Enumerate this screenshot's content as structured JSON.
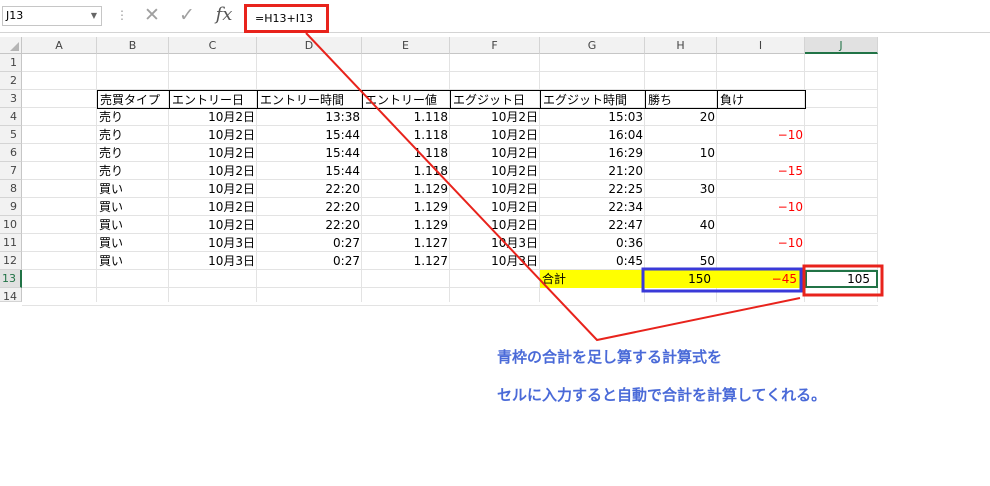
{
  "formula_bar": {
    "name_box": "J13",
    "formula": "=H13+I13",
    "fx_label": "fx"
  },
  "columns": [
    "A",
    "B",
    "C",
    "D",
    "E",
    "F",
    "G",
    "H",
    "I",
    "J"
  ],
  "rows": [
    "1",
    "2",
    "3",
    "4",
    "5",
    "6",
    "7",
    "8",
    "9",
    "10",
    "11",
    "12",
    "13",
    "14"
  ],
  "selected": {
    "column": "J",
    "row": "13"
  },
  "table": {
    "headers": [
      "売買タイプ",
      "エントリー日",
      "エントリー時間",
      "エントリー値",
      "エグジット日",
      "エグジット時間",
      "勝ち",
      "負け"
    ],
    "rows": [
      [
        "売り",
        "10月2日",
        "13:38",
        "1.118",
        "10月2日",
        "15:03",
        "20",
        ""
      ],
      [
        "売り",
        "10月2日",
        "15:44",
        "1.118",
        "10月2日",
        "16:04",
        "",
        "−10"
      ],
      [
        "売り",
        "10月2日",
        "15:44",
        "1.118",
        "10月2日",
        "16:29",
        "10",
        ""
      ],
      [
        "売り",
        "10月2日",
        "15:44",
        "1.118",
        "10月2日",
        "21:20",
        "",
        "−15"
      ],
      [
        "買い",
        "10月2日",
        "22:20",
        "1.129",
        "10月2日",
        "22:25",
        "30",
        ""
      ],
      [
        "買い",
        "10月2日",
        "22:20",
        "1.129",
        "10月2日",
        "22:34",
        "",
        "−10"
      ],
      [
        "買い",
        "10月2日",
        "22:20",
        "1.129",
        "10月2日",
        "22:47",
        "40",
        ""
      ],
      [
        "買い",
        "10月3日",
        "0:27",
        "1.127",
        "10月3日",
        "0:36",
        "",
        "−10"
      ],
      [
        "買い",
        "10月3日",
        "0:27",
        "1.127",
        "10月3日",
        "0:45",
        "50",
        ""
      ]
    ]
  },
  "totals": {
    "label": "合計",
    "win": "150",
    "loss": "−45",
    "sum": "105"
  },
  "note": {
    "line1": "青枠の合計を足し算する計算式を",
    "line2": "セルに入力すると自動で合計を計算してくれる。"
  },
  "colors": {
    "red_frame": "#e8231c",
    "blue_frame": "#3a3ad8",
    "total_fill": "#ffff00",
    "note_text": "#4a6ad8",
    "negative": "#ff0000",
    "selection": "#217346"
  }
}
